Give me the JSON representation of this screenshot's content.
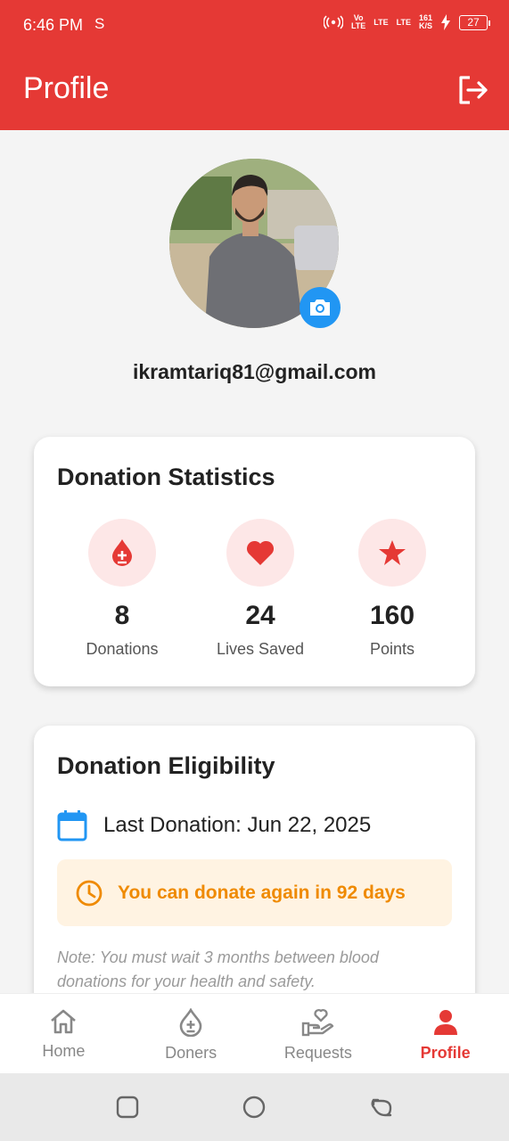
{
  "status_bar": {
    "time": "6:46 PM",
    "sim_glyph": "S",
    "signal1": "Vo\nLTE",
    "signal2": "LTE",
    "signal3": "LTE",
    "speed_value": "161",
    "speed_unit": "K/S",
    "battery": "27"
  },
  "app_bar": {
    "title": "Profile",
    "logout_icon": "logout-icon"
  },
  "profile": {
    "email": "ikramtariq81@gmail.com",
    "camera_icon": "camera-icon"
  },
  "stats_card": {
    "title": "Donation Statistics",
    "items": [
      {
        "icon": "blood-drop-icon",
        "value": "8",
        "label": "Donations"
      },
      {
        "icon": "heart-icon",
        "value": "24",
        "label": "Lives Saved"
      },
      {
        "icon": "star-icon",
        "value": "160",
        "label": "Points"
      }
    ]
  },
  "eligibility_card": {
    "title": "Donation Eligibility",
    "last_donation": "Last Donation: Jun 22, 2025",
    "wait_message": "You can donate again in 92 days",
    "note": "Note: You must wait 3 months between blood donations for your health and safety."
  },
  "bottom_nav": {
    "items": [
      {
        "label": "Home",
        "icon": "home-icon",
        "active": false
      },
      {
        "label": "Doners",
        "icon": "blood-drop-outline-icon",
        "active": false
      },
      {
        "label": "Requests",
        "icon": "hand-heart-icon",
        "active": false
      },
      {
        "label": "Profile",
        "icon": "person-icon",
        "active": true
      }
    ]
  },
  "colors": {
    "primary": "#e53935",
    "accent_blue": "#2196f3",
    "warning": "#ef8a00",
    "warning_bg": "#fff3e2",
    "icon_bg": "#fde7e7"
  }
}
